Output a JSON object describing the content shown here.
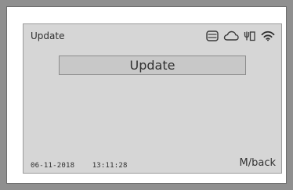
{
  "header": {
    "title": "Update",
    "icons": [
      "storage-icon",
      "cloud-icon",
      "antenna-icon",
      "wifi-icon"
    ]
  },
  "main": {
    "update_button_label": "Update"
  },
  "footer": {
    "date": "06-11-2018",
    "time": "13:11:28",
    "back_hint": "M/back"
  },
  "colors": {
    "screen_background": "#d6d6d6",
    "button_background": "#c8c8c8",
    "text": "#2f2f2f",
    "outer_background": "#8f8f8f"
  }
}
